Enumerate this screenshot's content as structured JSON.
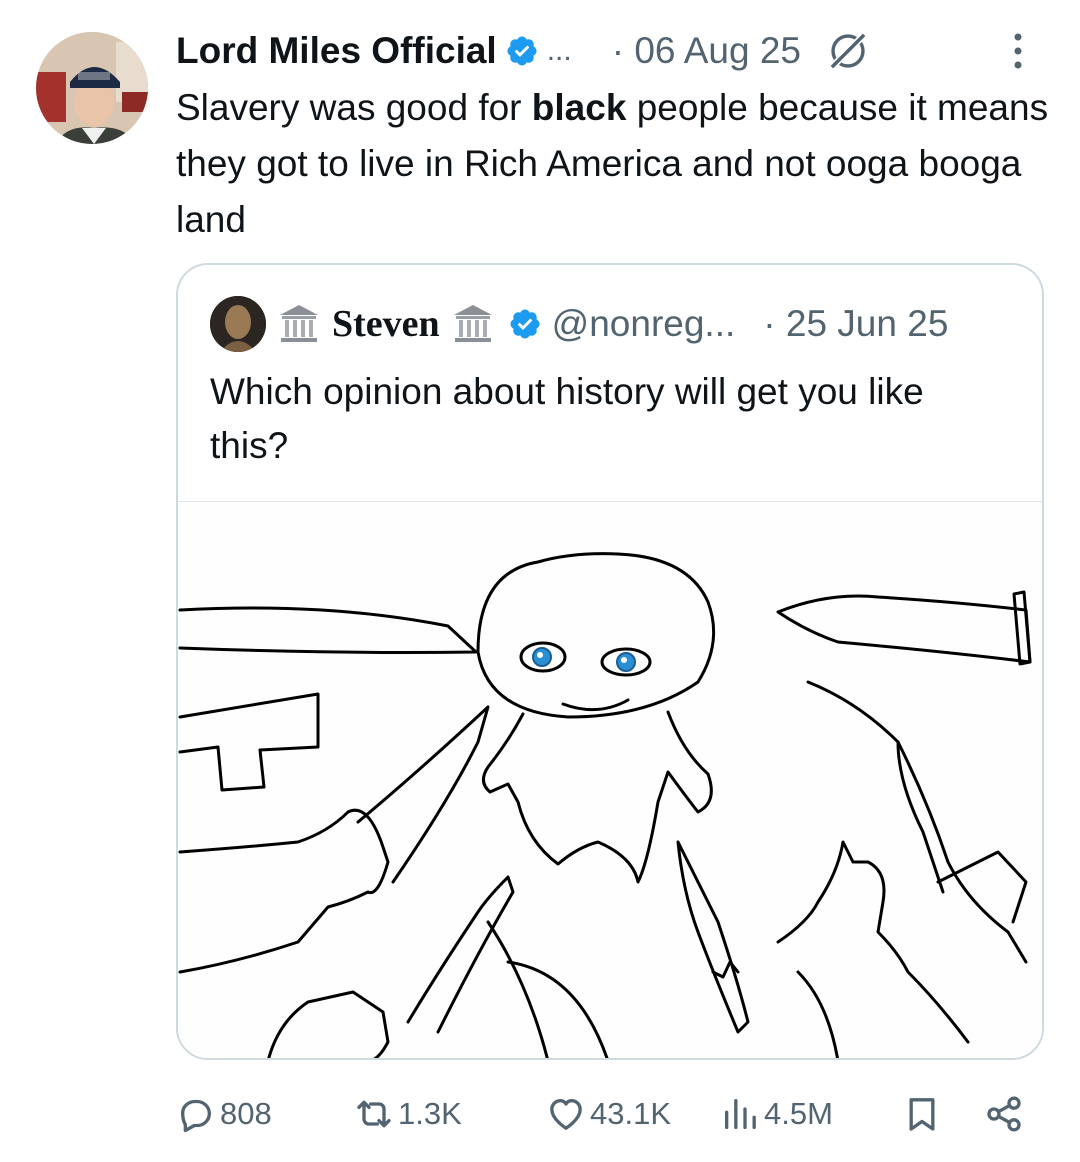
{
  "tweet": {
    "author": "Lord Miles Official",
    "name_ellipsis": "...",
    "date": "· 06 Aug 25",
    "text_before": "Slavery was good for ",
    "text_bold": "black",
    "text_after": " people because it means they got to live in Rich America and not ooga booga land"
  },
  "quote": {
    "name": "Steven",
    "handle": "@nonreg...",
    "date": "· 25 Jun 25",
    "text": "Which opinion about history will get you like this?"
  },
  "actions": {
    "replies": "808",
    "retweets": "1.3K",
    "likes": "43.1K",
    "views": "4.5M"
  },
  "colors": {
    "verified": "#1d9bf0",
    "secondary_text": "#536471",
    "border": "#cfd9de"
  },
  "icons": [
    "verified-badge-icon",
    "grok-icon",
    "more-options-icon",
    "bank-building-icon",
    "reply-icon",
    "retweet-icon",
    "like-icon",
    "views-icon",
    "bookmark-icon",
    "share-icon"
  ]
}
